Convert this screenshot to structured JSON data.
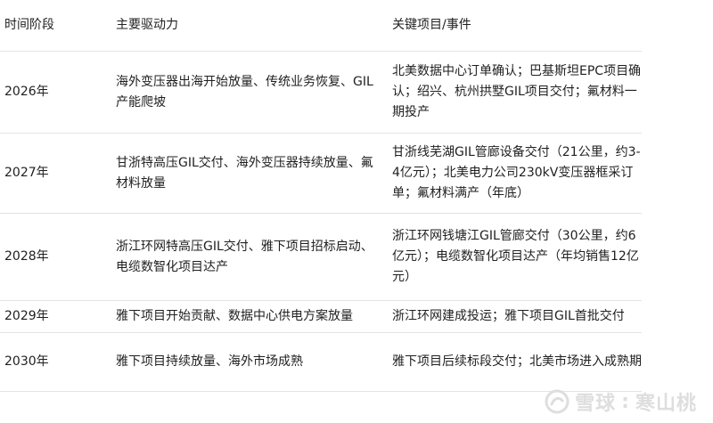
{
  "table": {
    "headers": [
      "时间阶段",
      "主要驱动力",
      "关键项目/事件"
    ],
    "rows": [
      {
        "period": "2026年",
        "drivers": "海外变压器出海开始放量、传统业务恢复、GIL产能爬坡",
        "events": "北美数据中心订单确认；巴基斯坦EPC项目确认；绍兴、杭州拱墅GIL项目交付；氟材料一期投产"
      },
      {
        "period": "2027年",
        "drivers": "甘浙特高压GIL交付、海外变压器持续放量、氟材料放量",
        "events": "甘浙线芜湖GIL管廊设备交付（21公里，约3-4亿元）；北美电力公司230kV变压器框采订单；氟材料满产（年底）"
      },
      {
        "period": "2028年",
        "drivers": "浙江环网特高压GIL交付、雅下项目招标启动、电缆数智化项目达产",
        "events": "浙江环网钱塘江GIL管廊交付（30公里，约6亿元）；电缆数智化项目达产（年均销售12亿元）"
      },
      {
        "period": "2029年",
        "drivers": "雅下项目开始贡献、数据中心供电方案放量",
        "events": "浙江环网建成投运；雅下项目GIL首批交付"
      },
      {
        "period": "2030年",
        "drivers": "雅下项目持续放量、海外市场成熟",
        "events": "雅下项目后续标段交付；北美市场进入成熟期"
      }
    ]
  },
  "watermark": {
    "brand": "雪球",
    "separator": ":",
    "author": "寒山桃",
    "icon": "snowball-logo-icon"
  }
}
